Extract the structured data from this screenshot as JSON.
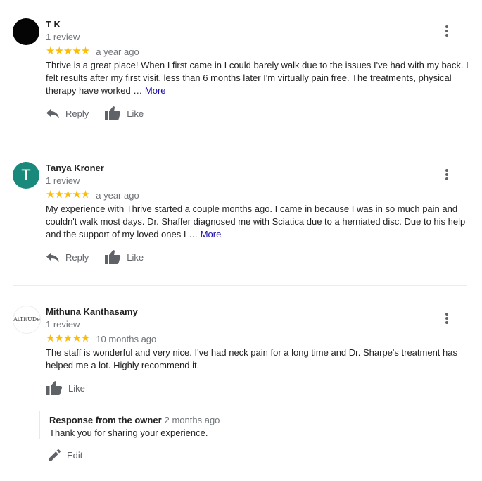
{
  "colors": {
    "star": "#fbbc04",
    "more_link": "#1a0dab",
    "avatar_teal": "#18897a",
    "muted": "#70757a"
  },
  "reviews": [
    {
      "name": "T K",
      "review_count": "1 review",
      "stars": "★★★★★",
      "rating": 5,
      "time": "a year ago",
      "text": "Thrive is a great place! When I first came in I could barely walk due to the issues I've had with my back. I felt results after my first visit,  less than 6 months later I'm virtually pain free. The treatments, physical therapy have worked …",
      "more": "More",
      "reply_label": "Reply",
      "like_label": "Like",
      "avatar_style": "dark-circle"
    },
    {
      "name": "Tanya Kroner",
      "review_count": "1 review",
      "stars": "★★★★★",
      "rating": 5,
      "time": "a year ago",
      "text": "My experience with Thrive started a couple months ago. I came in because I was in so much pain and couldn't walk most days. Dr. Shaffer diagnosed me with Sciatica due to a herniated disc. Due to his help and the support of my loved ones I …",
      "more": "More",
      "reply_label": "Reply",
      "like_label": "Like",
      "avatar_letter": "T"
    },
    {
      "name": "Mithuna Kanthasamy",
      "review_count": "1 review",
      "stars": "★★★★★",
      "rating": 5,
      "time": "10 months ago",
      "text": "The staff is wonderful and very nice. I've had neck pain for a long time and Dr. Sharpe's treatment has helped me a lot. Highly recommend it.",
      "like_label": "Like",
      "avatar_text": "AtTitUDe",
      "owner_response": {
        "title": "Response from the owner",
        "time": "2 months ago",
        "text": "Thank you for sharing your experience."
      },
      "edit_label": "Edit"
    }
  ]
}
